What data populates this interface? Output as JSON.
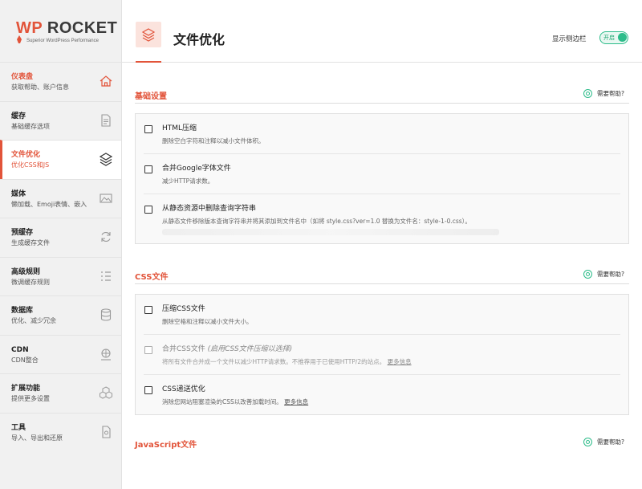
{
  "brand": {
    "logo_wp": "WP",
    "logo_rocket": "ROCKET",
    "tagline": "Superior WordPress Performance",
    "accent": "#e2543a"
  },
  "sidebar": {
    "items": [
      {
        "title": "仪表盘",
        "sub": "获取帮助、账户信息",
        "icon": "home-icon",
        "active": false,
        "highlight": true
      },
      {
        "title": "缓存",
        "sub": "基础缓存选项",
        "icon": "document-icon",
        "active": false
      },
      {
        "title": "文件优化",
        "sub": "优化CSS和JS",
        "icon": "layers-icon",
        "active": true
      },
      {
        "title": "媒体",
        "sub": "懒加载、Emoji表情、嵌入",
        "icon": "image-icon",
        "active": false
      },
      {
        "title": "预缓存",
        "sub": "生成缓存文件",
        "icon": "refresh-icon",
        "active": false
      },
      {
        "title": "高级规则",
        "sub": "微调缓存规则",
        "icon": "list-icon",
        "active": false
      },
      {
        "title": "数据库",
        "sub": "优化、减少冗余",
        "icon": "database-icon",
        "active": false
      },
      {
        "title": "CDN",
        "sub": "CDN整合",
        "icon": "cdn-icon",
        "active": false
      },
      {
        "title": "扩展功能",
        "sub": "提供更多设置",
        "icon": "cubes-icon",
        "active": false
      },
      {
        "title": "工具",
        "sub": "导入、导出和还原",
        "icon": "tools-icon",
        "active": false
      }
    ]
  },
  "header": {
    "title": "文件优化",
    "sidebar_toggle_label": "显示侧边栏",
    "toggle_text": "开启",
    "toggle_state": "on"
  },
  "sections": {
    "basic": {
      "title": "基础设置",
      "help": "需要帮助?",
      "options": [
        {
          "title": "HTML压缩",
          "desc": "删除空白字符和注释以减小文件体积。"
        },
        {
          "title": "合并Google字体文件",
          "desc": "减少HTTP请求数。"
        },
        {
          "title": "从静态资源中删除查询字符串",
          "desc": "从静态文件移除版本查询字符串并将其添加到文件名中（如将 style.css?ver=1.0 替换为文件名：style-1-0.css）。"
        }
      ]
    },
    "css": {
      "title": "CSS文件",
      "help": "需要帮助?",
      "options": [
        {
          "title": "压缩CSS文件",
          "desc": "删除空格和注释以减小文件大小。"
        },
        {
          "title": "合并CSS文件",
          "note": "(启用CSS文件压缩以选择)",
          "desc": "将所有文件合并成一个文件以减少HTTP请求数。不推荐用于已使用HTTP/2的站点。",
          "link": "更多信息",
          "disabled": true
        },
        {
          "title": "CSS递送优化",
          "desc": "消除您网站阻塞渲染的CSS以改善加载时间。",
          "link": "更多信息"
        }
      ]
    },
    "js": {
      "title": "JavaScript文件",
      "help": "需要帮助?"
    }
  }
}
